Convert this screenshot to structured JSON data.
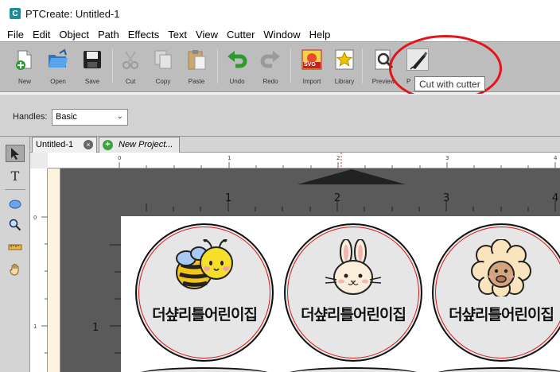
{
  "app": {
    "logo_letter": "C",
    "title": "PTCreate: Untitled-1"
  },
  "menu": [
    "File",
    "Edit",
    "Object",
    "Path",
    "Effects",
    "Text",
    "View",
    "Cutter",
    "Window",
    "Help"
  ],
  "toolbar": {
    "new": "New",
    "open": "Open",
    "save": "Save",
    "cut": "Cut",
    "copy": "Copy",
    "paste": "Paste",
    "undo": "Undo",
    "redo": "Redo",
    "import": "Import",
    "library": "Library",
    "preview": "Preview",
    "cut_with_cutter_partial": "P",
    "svg_badge": "SVG",
    "tooltip": "Cut with cutter"
  },
  "options": {
    "handles_label": "Handles:",
    "handles_value": "Basic"
  },
  "tabs": {
    "untitled": "Untitled-1",
    "new_project": "New Project..."
  },
  "rulers": {
    "h_small": [
      "0",
      "1",
      "2",
      "3",
      "4"
    ],
    "h_large": [
      "1",
      "2",
      "3",
      "4"
    ],
    "v_small": [
      "0",
      "1"
    ],
    "v_large": [
      "1"
    ]
  },
  "stickers": [
    {
      "caption": "더샾리틀어린이집",
      "icon": "bee-icon"
    },
    {
      "caption": "더샾리틀어린이집",
      "icon": "bunny-icon"
    },
    {
      "caption": "더샾리틀어린이집",
      "icon": "sheep-icon"
    }
  ],
  "colors": {
    "accent_ring": "#e4141a",
    "sticker_border": "#d41c1c",
    "canvas": "#5a5a5a"
  }
}
